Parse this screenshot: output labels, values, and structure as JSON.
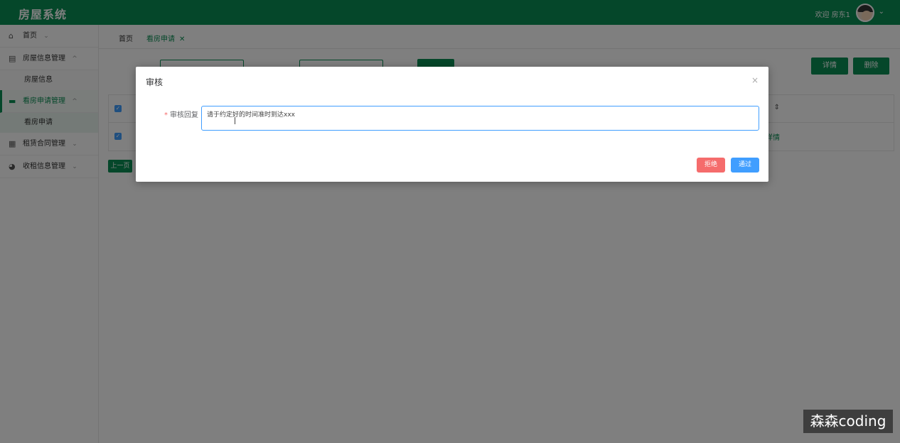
{
  "header": {
    "title": "房屋系统",
    "welcome": "欢迎 房东1",
    "caret": "⌄"
  },
  "sidebar": {
    "items": [
      {
        "label": "首页",
        "arrow": "⌄",
        "icon": "⌂"
      },
      {
        "label": "房屋信息管理",
        "arrow": "^",
        "icon": "▤"
      },
      {
        "label": "房屋信息"
      },
      {
        "label": "看房申请管理",
        "arrow": "^",
        "icon": "▬"
      },
      {
        "label": "看房申请"
      },
      {
        "label": "租赁合同管理",
        "arrow": "⌄",
        "icon": "▦"
      },
      {
        "label": "收租信息管理",
        "arrow": "⌄",
        "icon": "◕"
      }
    ]
  },
  "tabs": {
    "home": "首页",
    "current": "看房申请",
    "close": "✕"
  },
  "toolbar": {
    "detail": "详情",
    "delete": "删除"
  },
  "table": {
    "detail_link": "详情",
    "sort_icon": "⇕"
  },
  "pager": {
    "prev": "上一页"
  },
  "dialog": {
    "title": "审核",
    "close": "×",
    "label": "审核回复",
    "required_mark": "*",
    "reply_value": "请于约定好的时间准时到达xxx",
    "reject": "拒绝",
    "pass": "通过"
  },
  "watermark": "森森coding",
  "colors": {
    "brand": "#0a8f55",
    "primary": "#409eff",
    "danger": "#f56c6c"
  }
}
